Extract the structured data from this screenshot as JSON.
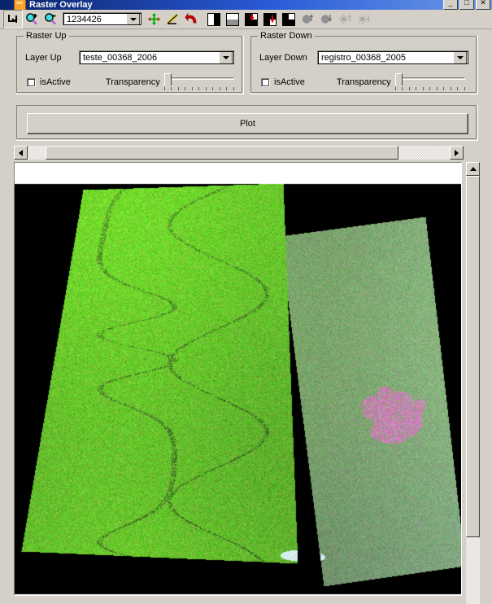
{
  "window": {
    "title": "Raster Overlay",
    "icon": "app-icon",
    "controls": [
      {
        "name": "minimize-button",
        "glyph": "_"
      },
      {
        "name": "maximize-button",
        "glyph": "□"
      },
      {
        "name": "close-button",
        "glyph": "✕"
      }
    ]
  },
  "toolbar": {
    "zoom_value": "1234426",
    "buttons": [
      {
        "name": "arrow-down-right-icon",
        "pressed": true
      },
      {
        "name": "zoom-in-icon",
        "pressed": false
      },
      {
        "name": "zoom-out-icon",
        "pressed": false
      },
      {
        "name": "pan-move-icon",
        "pressed": false
      },
      {
        "name": "measure-line-icon",
        "pressed": false
      },
      {
        "name": "undo-arrow-icon",
        "pressed": false
      },
      {
        "name": "contrast-vertical-icon",
        "pressed": false
      },
      {
        "name": "contrast-horizontal-icon",
        "pressed": false
      },
      {
        "name": "red-band-up-icon",
        "pressed": false
      },
      {
        "name": "red-band-down-icon",
        "pressed": false
      },
      {
        "name": "gray-band-icon",
        "pressed": false
      },
      {
        "name": "contrast-increase-icon",
        "pressed": false
      },
      {
        "name": "contrast-decrease-icon",
        "pressed": false
      },
      {
        "name": "brightness-increase-icon",
        "pressed": false
      },
      {
        "name": "brightness-decrease-icon",
        "pressed": false
      }
    ]
  },
  "raster_up": {
    "group_title": "Raster Up",
    "layer_label": "Layer Up",
    "layer_value": "teste_00368_2006",
    "is_active_label": "isActive",
    "is_active_checked": false,
    "transparency_label": "Transparency",
    "transparency_value": 0
  },
  "raster_down": {
    "group_title": "Raster Down",
    "layer_label": "Layer Down",
    "layer_value": "registro_00368_2005",
    "is_active_label": "isActive",
    "is_active_checked": false,
    "transparency_label": "Transparency",
    "transparency_value": 0
  },
  "actions": {
    "plot_label": "Plot"
  },
  "scrollbars": {
    "h_left_arrow": "◄",
    "h_right_arrow": "►",
    "v_up_arrow": "▲"
  },
  "colors": {
    "window_face": "#d4d0c8",
    "title_active": "#0a246a",
    "canvas_background": "#000000",
    "raster_up_green": "#5fc01f",
    "raster_down_green": "#6aa86a",
    "raster_down_magenta": "#c060a8"
  }
}
